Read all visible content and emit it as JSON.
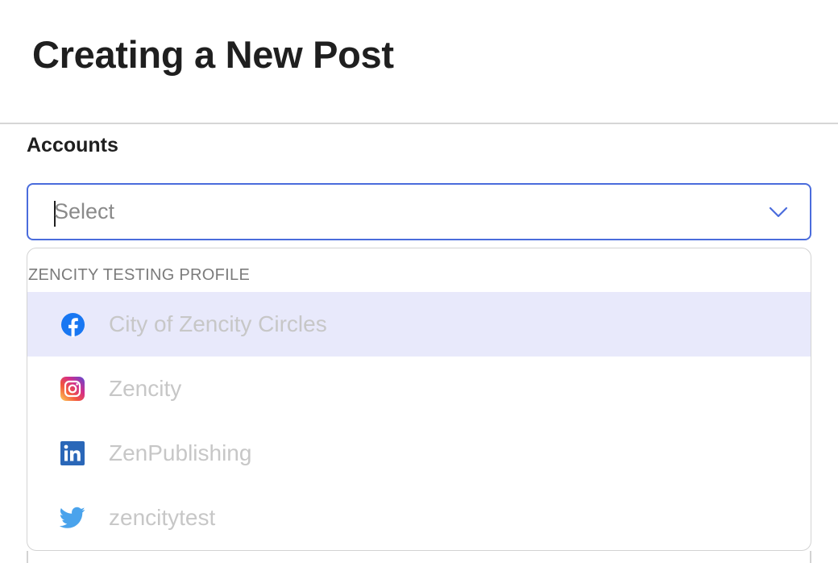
{
  "header": {
    "title": "Creating a New Post"
  },
  "accounts": {
    "label": "Accounts",
    "select": {
      "placeholder": "Select",
      "value": ""
    },
    "menu": {
      "group_header": "ZENCITY TESTING PROFILE",
      "options": [
        {
          "label": "City of Zencity Circles",
          "icon": "facebook-icon",
          "highlighted": true
        },
        {
          "label": "Zencity",
          "icon": "instagram-icon",
          "highlighted": false
        },
        {
          "label": "ZenPublishing",
          "icon": "linkedin-icon",
          "highlighted": false
        },
        {
          "label": "zencitytest",
          "icon": "twitter-icon",
          "highlighted": false
        }
      ]
    }
  },
  "colors": {
    "focus_border": "#4a6cdc",
    "highlight_bg": "#e8e9fb",
    "facebook": "#1877f2",
    "linkedin": "#0a66c2",
    "twitter": "#1da1f2"
  }
}
